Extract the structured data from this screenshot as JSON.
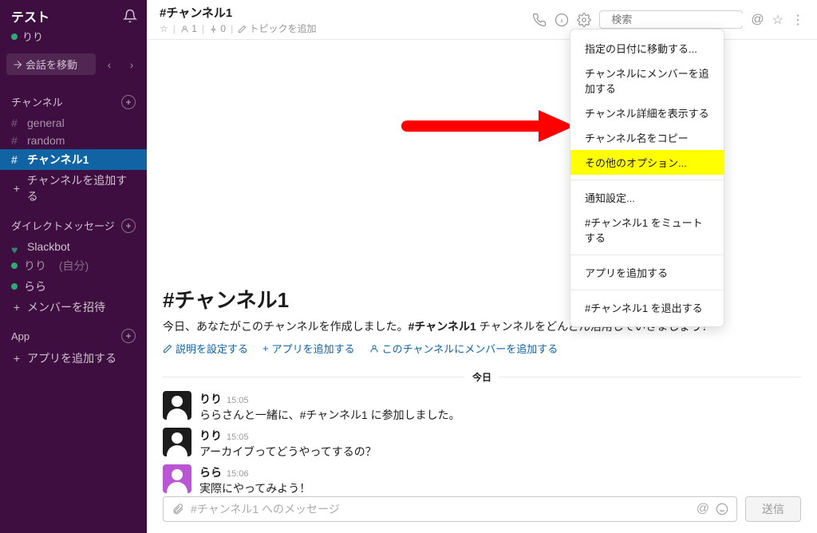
{
  "workspace": {
    "name": "テスト",
    "user": "りり"
  },
  "sidebar": {
    "jump_label": "会話を移動",
    "sections": {
      "channels": {
        "title": "チャンネル",
        "items": [
          {
            "prefix": "#",
            "label": "general"
          },
          {
            "prefix": "#",
            "label": "random"
          },
          {
            "prefix": "#",
            "label": "チャンネル1"
          }
        ],
        "add": "チャンネルを追加する"
      },
      "dms": {
        "title": "ダイレクトメッセージ",
        "items": [
          {
            "label": "Slackbot"
          },
          {
            "label": "りり",
            "suffix": "(自分)"
          },
          {
            "label": "らら"
          }
        ],
        "invite": "メンバーを招待"
      },
      "apps": {
        "title": "App",
        "add": "アプリを追加する"
      }
    }
  },
  "header": {
    "channel_name": "#チャンネル1",
    "members": "1",
    "pins": "0",
    "topic_placeholder": "トピックを追加",
    "search_placeholder": "検索"
  },
  "dropdown": {
    "items": [
      "指定の日付に移動する...",
      "チャンネルにメンバーを追加する",
      "チャンネル詳細を表示する",
      "チャンネル名をコピー",
      "その他のオプション..."
    ],
    "group2": [
      "通知設定...",
      "#チャンネル1 をミュートする"
    ],
    "group3": [
      "アプリを追加する"
    ],
    "group4": [
      "#チャンネル1 を退出する"
    ]
  },
  "intro": {
    "title": "#チャンネル1",
    "desc_pre": "今日、あなたがこのチャンネルを作成しました。",
    "desc_bold": "#チャンネル1",
    "desc_post": " チャンネルをどんどん活用していきましょう！",
    "link1": "説明を設定する",
    "link2": "アプリを追加する",
    "link3": "このチャンネルにメンバーを追加する"
  },
  "date_divider": "今日",
  "messages": [
    {
      "user": "りり",
      "time": "15:05",
      "text": "ららさんと一緒に、#チャンネル1 に参加しました。",
      "avatar": "black"
    },
    {
      "user": "りり",
      "time": "15:05",
      "text": "アーカイブってどうやってするの？",
      "avatar": "black"
    },
    {
      "user": "らら",
      "time": "15:06",
      "text": "実際にやってみよう！",
      "avatar": "purple"
    }
  ],
  "composer": {
    "placeholder": "#チャンネル1 へのメッセージ",
    "send": "送信"
  }
}
